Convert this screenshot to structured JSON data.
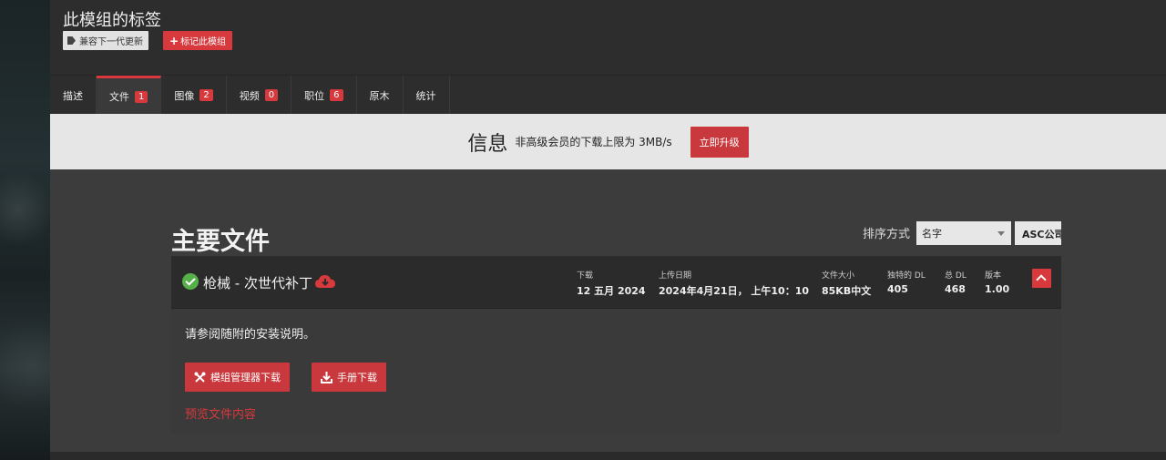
{
  "tags": {
    "title": "此模组的标签",
    "chips": [
      "兼容下一代更新"
    ],
    "flag_button": "标记此模组",
    "flag_plus": "+"
  },
  "tabs": [
    {
      "label": "描述",
      "count": null
    },
    {
      "label": "文件",
      "count": "1",
      "active": true
    },
    {
      "label": "图像",
      "count": "2"
    },
    {
      "label": "视频",
      "count": "0"
    },
    {
      "label": "职位",
      "count": "6"
    },
    {
      "label": "原木",
      "count": null
    },
    {
      "label": "统计",
      "count": null
    }
  ],
  "info": {
    "title": "信息",
    "text": "非高级会员的下载上限为 3MB/s",
    "upgrade_button": "立即升级"
  },
  "files_section": {
    "title": "主要文件",
    "sort_label": "排序方式",
    "sort_value": "名字",
    "order_value": "ASC公司"
  },
  "file": {
    "name": "枪械 - 次世代补丁",
    "meta": {
      "download_label": "下载",
      "download_value": "12 五月 2024",
      "upload_label": "上传日期",
      "upload_value": "2024年4月21日， 上午10：10",
      "size_label": "文件大小",
      "size_value": "85KB中文",
      "unique_dl_label": "独特的 DL",
      "unique_dl_value": "405",
      "total_dl_label": "总 DL",
      "total_dl_value": "468",
      "version_label": "版本",
      "version_value": "1.00"
    },
    "description": "请参阅随附的安装说明。",
    "mod_manager_button": "模组管理器下载",
    "manual_button": "手册下载",
    "preview_link": "预览文件内容"
  },
  "colors": {
    "accent": "#d7393d",
    "success": "#56b04a",
    "banner_bg": "#e6e6e6"
  }
}
